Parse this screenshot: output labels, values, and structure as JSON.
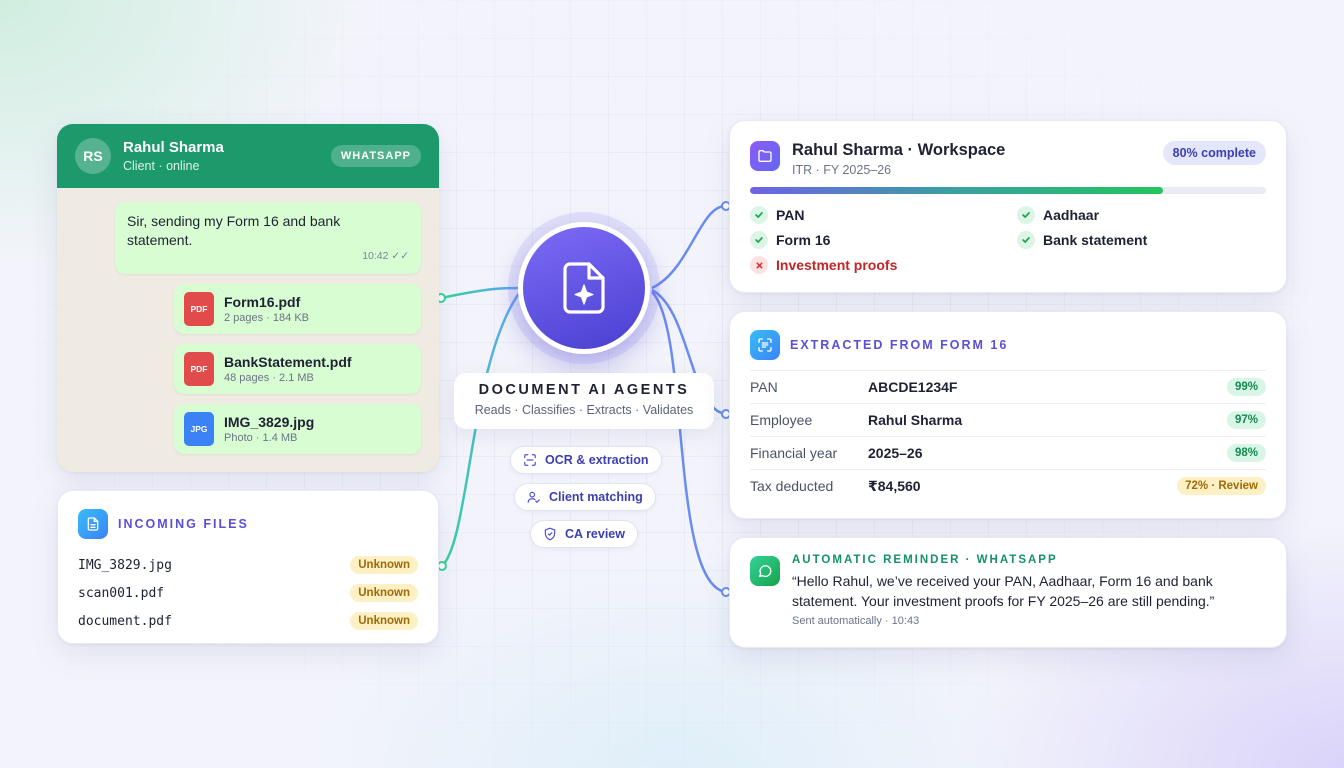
{
  "chat": {
    "avatar_initials": "RS",
    "name": "Rahul Sharma",
    "status": "Client · online",
    "badge": "WHATSAPP",
    "message": "Sir, sending my Form 16 and bank statement.",
    "message_time": "10:42 ✓✓",
    "attachments": [
      {
        "type": "PDF",
        "name": "Form16.pdf",
        "meta": "2 pages · 184 KB"
      },
      {
        "type": "PDF",
        "name": "BankStatement.pdf",
        "meta": "48 pages · 2.1 MB"
      },
      {
        "type": "JPG",
        "name": "IMG_3829.jpg",
        "meta": "Photo · 1.4 MB"
      }
    ]
  },
  "incoming": {
    "title": "INCOMING FILES",
    "icon": "document-icon",
    "files": [
      {
        "name": "IMG_3829.jpg",
        "status": "Unknown"
      },
      {
        "name": "scan001.pdf",
        "status": "Unknown"
      },
      {
        "name": "document.pdf",
        "status": "Unknown"
      }
    ]
  },
  "agent": {
    "icon": "ai-document-icon",
    "title": "DOCUMENT AI AGENTS",
    "subtitle": "Reads · Classifies · Extracts · Validates",
    "chips": [
      {
        "label": "OCR & extraction",
        "icon": "scan-icon"
      },
      {
        "label": "Client matching",
        "icon": "user-match-icon"
      },
      {
        "label": "CA review",
        "icon": "shield-icon"
      }
    ]
  },
  "workspace": {
    "title": "Rahul Sharma · Workspace",
    "subtitle": "ITR · FY 2025–26",
    "icon": "folder-icon",
    "progress_label": "80% complete",
    "progress_fraction": 0.8,
    "checklist": [
      {
        "label": "PAN",
        "done": true
      },
      {
        "label": "Aadhaar",
        "done": true
      },
      {
        "label": "Form 16",
        "done": true
      },
      {
        "label": "Bank statement",
        "done": true
      },
      {
        "label": "Investment proofs",
        "done": false
      }
    ]
  },
  "extracted": {
    "title": "EXTRACTED FROM FORM 16",
    "icon": "scan-text-icon",
    "rows": [
      {
        "label": "PAN",
        "value": "ABCDE1234F",
        "confidence": "99%",
        "level": "ok"
      },
      {
        "label": "Employee",
        "value": "Rahul Sharma",
        "confidence": "97%",
        "level": "ok"
      },
      {
        "label": "Financial year",
        "value": "2025–26",
        "confidence": "98%",
        "level": "ok"
      },
      {
        "label": "Tax deducted",
        "value": "₹84,560",
        "confidence": "72% · Review",
        "level": "warn"
      }
    ]
  },
  "reminder": {
    "title": "AUTOMATIC REMINDER · WHATSAPP",
    "icon": "chat-bubble-icon",
    "text": "“Hello Rahul, we’ve received your PAN, Aadhaar, Form 16 and bank statement. Your investment proofs for FY 2025–26 are still pending.”",
    "meta": "Sent automatically · 10:43"
  },
  "colors": {
    "whatsapp_green": "#1d9a6c",
    "accent_purple": "#5b4fd6",
    "success_green": "#22c55e",
    "error_red": "#c02626",
    "warning_amber": "#a06a05"
  }
}
